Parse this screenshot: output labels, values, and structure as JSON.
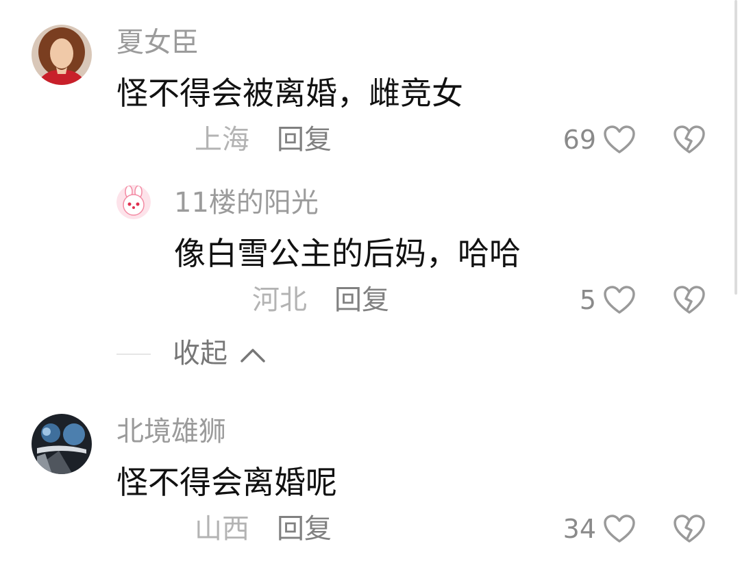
{
  "comments": [
    {
      "username": "夏女臣",
      "text": "怪不得会被离婚，雌竞女",
      "location": "上海",
      "reply_label": "回复",
      "likes": "69",
      "replies": [
        {
          "username": "11楼的阳光",
          "text": "像白雪公主的后妈，哈哈",
          "location": "河北",
          "reply_label": "回复",
          "likes": "5"
        }
      ],
      "collapse_label": "收起"
    },
    {
      "username": "北境雄狮",
      "text": "怪不得会离婚呢",
      "location": "山西",
      "reply_label": "回复",
      "likes": "34"
    }
  ],
  "icons": {
    "like": "heart-outline-icon",
    "dislike": "broken-heart-icon",
    "collapse": "chevron-up-icon"
  },
  "colors": {
    "username": "#9b9b9b",
    "text": "#111111",
    "secondary": "#b3b3b3"
  }
}
